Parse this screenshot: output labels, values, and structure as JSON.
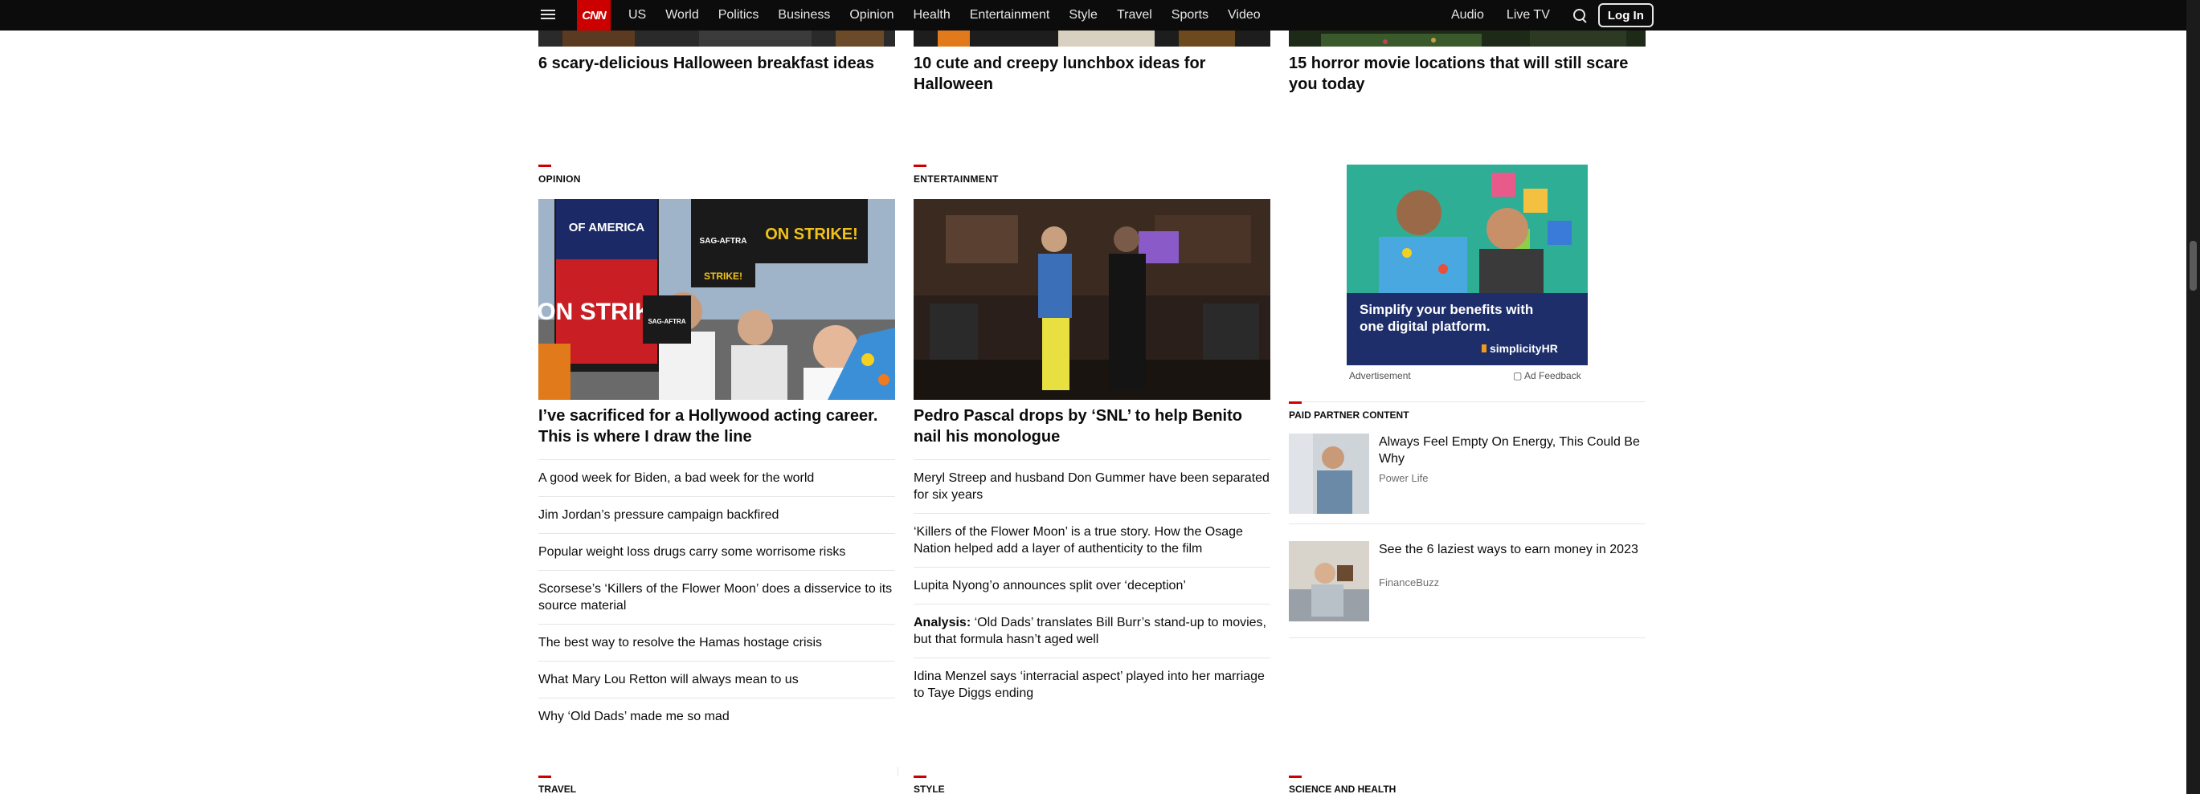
{
  "nav": {
    "logo": "CNN",
    "links": [
      "US",
      "World",
      "Politics",
      "Business",
      "Opinion",
      "Health",
      "Entertainment",
      "Style",
      "Travel",
      "Sports",
      "Video"
    ],
    "audio": "Audio",
    "live_tv": "Live TV",
    "login": "Log In"
  },
  "top_row": [
    {
      "title": "6 scary-delicious Halloween breakfast ideas"
    },
    {
      "title": "10 cute and creepy lunchbox ideas for Halloween"
    },
    {
      "title": "15 horror movie locations that will still scare you today"
    }
  ],
  "opinion": {
    "label": "Opinion",
    "hero_title": "I’ve sacrificed for a Hollywood acting career. This is where I draw the line",
    "sign_texts": [
      "OF AMERICA",
      "ON STRIKE!",
      "SAG-AFTRA",
      "SAG-AFTRA",
      "ON STRIKE!",
      "STRIKE!"
    ],
    "items": [
      "A good week for Biden, a bad week for the world",
      "Jim Jordan’s pressure campaign backfired",
      "Popular weight loss drugs carry some worrisome risks",
      "Scorsese’s ‘Killers of the Flower Moon’ does a disservice to its source material",
      "The best way to resolve the Hamas hostage crisis",
      "What Mary Lou Retton will always mean to us",
      "Why ‘Old Dads’ made me so mad"
    ]
  },
  "entertainment": {
    "label": "Entertainment",
    "hero_title": "Pedro Pascal drops by ‘SNL’ to help Benito nail his monologue",
    "items": [
      {
        "prefix": "",
        "text": "Meryl Streep and husband Don Gummer have been separated for six years"
      },
      {
        "prefix": "",
        "text": "‘Killers of the Flower Moon’ is a true story. How the Osage Nation helped add a layer of authenticity to the film"
      },
      {
        "prefix": "",
        "text": "Lupita Nyong’o announces split over ‘deception’"
      },
      {
        "prefix": "Analysis:",
        "text": " ‘Old Dads’ translates Bill Burr’s stand-up to movies, but that formula hasn’t aged well"
      },
      {
        "prefix": "",
        "text": "Idina Menzel says ‘interracial aspect’ played into her marriage to Taye Diggs ending"
      }
    ]
  },
  "ad": {
    "headline_line1": "Simplify your benefits with",
    "headline_line2": "one digital platform.",
    "brand": "simplicityHR",
    "advertisement_label": "Advertisement",
    "feedback_label": "Ad Feedback"
  },
  "partner": {
    "label": "Paid Partner Content",
    "items": [
      {
        "title": "Always Feel Empty On Energy, This Could Be Why",
        "source": "Power Life"
      },
      {
        "title": "See the 6 laziest ways to earn money in 2023",
        "source": "FinanceBuzz"
      }
    ]
  },
  "bottom_labels": [
    "Travel",
    "Style",
    "Science and Health"
  ],
  "colors": {
    "brand": "#cc0000",
    "nav_bg": "#0c0c0c",
    "ad_blue": "#1e2e6b"
  }
}
